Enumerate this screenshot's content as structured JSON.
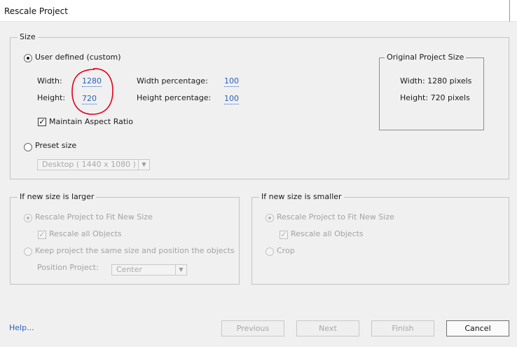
{
  "window": {
    "title": "Rescale Project"
  },
  "size_group": {
    "legend": "Size",
    "user_defined_label": "User defined (custom)",
    "width_label": "Width:",
    "width_value": "1280",
    "height_label": "Height:",
    "height_value": "720",
    "width_pct_label": "Width percentage:",
    "width_pct_value": "100",
    "height_pct_label": "Height percentage:",
    "height_pct_value": "100",
    "maintain_aspect_label": "Maintain Aspect Ratio",
    "preset_label": "Preset size",
    "preset_value": "Desktop ( 1440 x 1080 )"
  },
  "original_size": {
    "legend": "Original Project Size",
    "width_text": "Width: 1280 pixels",
    "height_text": "Height: 720 pixels"
  },
  "larger_group": {
    "legend": "If new size is larger",
    "rescale_fit_label": "Rescale Project to Fit New Size",
    "rescale_objects_label": "Rescale all Objects",
    "keep_size_label": "Keep project the same size and position the objects",
    "position_label": "Position Project:",
    "position_value": "Center"
  },
  "smaller_group": {
    "legend": "If new size is smaller",
    "rescale_fit_label": "Rescale Project to Fit New Size",
    "rescale_objects_label": "Rescale all Objects",
    "crop_label": "Crop"
  },
  "footer": {
    "help_label": "Help...",
    "previous_label": "Previous",
    "next_label": "Next",
    "finish_label": "Finish",
    "cancel_label": "Cancel"
  },
  "colors": {
    "link": "#2a60b8",
    "annotation": "#e0001b"
  }
}
